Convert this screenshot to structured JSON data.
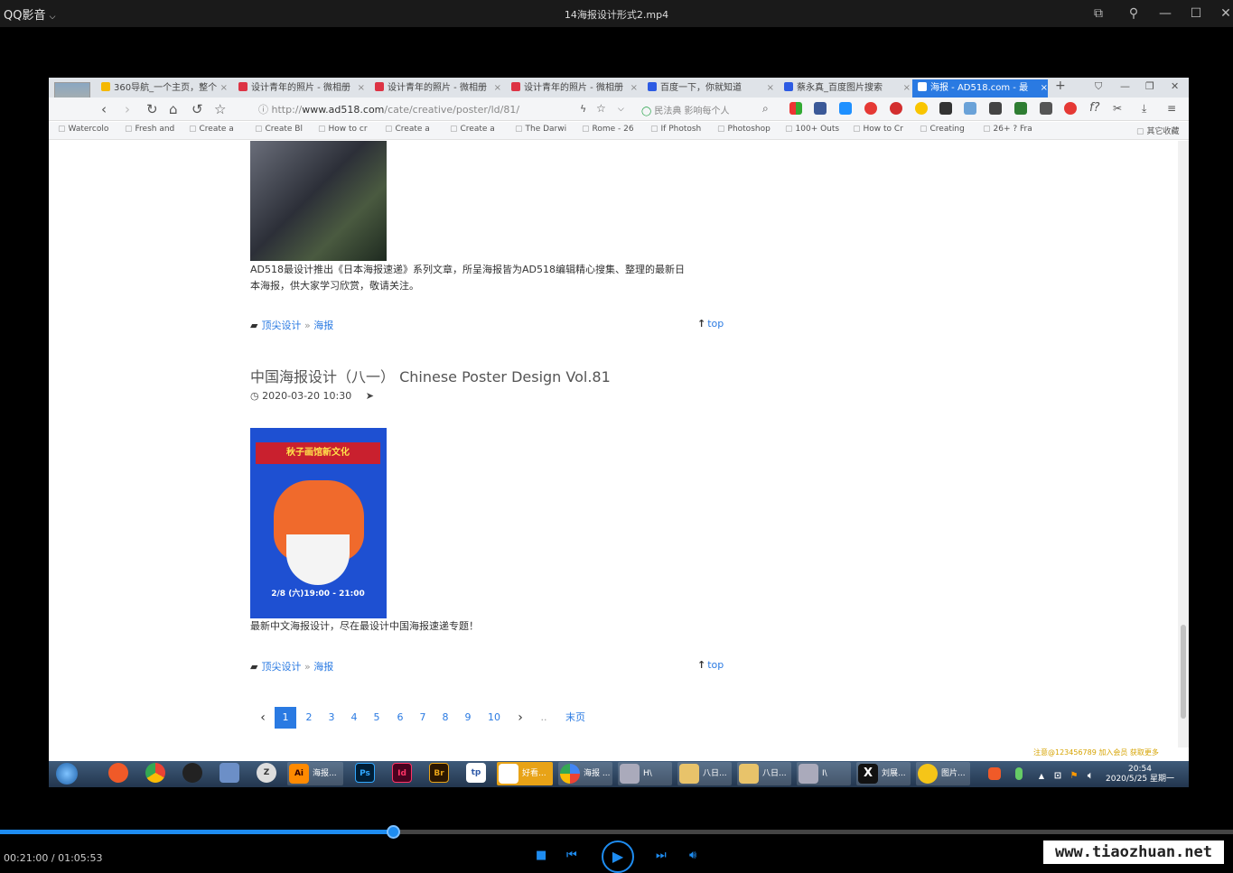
{
  "player": {
    "app_name": "QQ影音",
    "app_menu_arrow": "⌵",
    "file_title": "14海报设计形式2.mp4",
    "time": "00:21:00 / 01:05:53",
    "progress": 0.319,
    "watermark": "www.tiaozhuan.net"
  },
  "browser": {
    "tabs": [
      {
        "label": "360导航_一个主页，整个",
        "icon_color": "#f5b800"
      },
      {
        "label": "设计青年的照片 - 微相册",
        "icon_color": "#d34"
      },
      {
        "label": "设计青年的照片 - 微相册",
        "icon_color": "#d34"
      },
      {
        "label": "设计青年的照片 - 微相册",
        "icon_color": "#d34"
      },
      {
        "label": "百度一下，你就知道",
        "icon_color": "#2d5be3"
      },
      {
        "label": "蔡永真_百度图片搜索",
        "icon_color": "#2d5be3"
      },
      {
        "label": "海报 - AD518.com - 最",
        "icon_color": "#fff",
        "active": true
      }
    ],
    "new_tab": "+",
    "url_prefix": "http://",
    "url_host": "www.ad518.com",
    "url_path": "/cate/creative/poster/ld/81/",
    "search_placeholder": "民法典 影响每个人",
    "bookmarks": [
      "Watercolo",
      "Fresh and",
      "Create a",
      "Create Bl",
      "How to cr",
      "Create a",
      "Create a",
      "The Darwi",
      "Rome - 26",
      "If Photosh",
      "Photoshop",
      "100+ Outs",
      "How to Cr",
      "Creating",
      "26+ ? Fra"
    ],
    "other_bookmarks": "其它收藏"
  },
  "page": {
    "post1_desc_line1": "AD518最设计推出《日本海报速递》系列文章，所呈海报皆为AD518编辑精心搜集、整理的最新日",
    "post1_desc_line2": "本海报，供大家学习欣赏，敬请关注。",
    "category_primary": "顶尖设计",
    "category_sep": "»",
    "category_secondary": "海报",
    "top_label": "top",
    "post2_title": "中国海报设计（八一） Chinese Poster Design Vol.81",
    "post2_date": "2020-03-20 10:30",
    "post2_desc": "最新中文海报设计，尽在最设计中国海报速递专题！",
    "poster2_banner": "秋子画馆新文化",
    "poster2_date": "2/8 (六)19:00 - 21:00",
    "pagination": [
      "1",
      "2",
      "3",
      "4",
      "5",
      "6",
      "7",
      "8",
      "9",
      "10"
    ],
    "pagination_ellipsis": "..",
    "pagination_last": "末页"
  },
  "taskbar": {
    "tasks": [
      {
        "label": "海报...",
        "color": "#ff8a00",
        "app": "Ai"
      },
      {
        "label": "",
        "color": "#31a8ff",
        "app": "Ps"
      },
      {
        "label": "",
        "color": "#ff3366",
        "app": "Id"
      },
      {
        "label": "",
        "color": "#e8a317",
        "app": "Br"
      },
      {
        "label": "",
        "color": "#2f5aa8",
        "app": "tp"
      },
      {
        "label": "好看...",
        "color": "#f4b400",
        "app": ""
      },
      {
        "label": "海报 ...",
        "color": "#4285f4",
        "app": ""
      },
      {
        "label": "H\\",
        "color": "#aab",
        "app": ""
      },
      {
        "label": "八日...",
        "color": "#e8c36a",
        "app": ""
      },
      {
        "label": "八日...",
        "color": "#e8c36a",
        "app": ""
      },
      {
        "label": "I\\",
        "color": "#aab",
        "app": ""
      },
      {
        "label": "刘展...",
        "color": "#111",
        "app": "X"
      },
      {
        "label": "图片...",
        "color": "#f5c518",
        "app": ""
      }
    ],
    "clock_time": "20:54",
    "clock_date": "2020/5/25 星期一",
    "tray_watermark": "注意@123456789 加入会员 获取更多"
  }
}
